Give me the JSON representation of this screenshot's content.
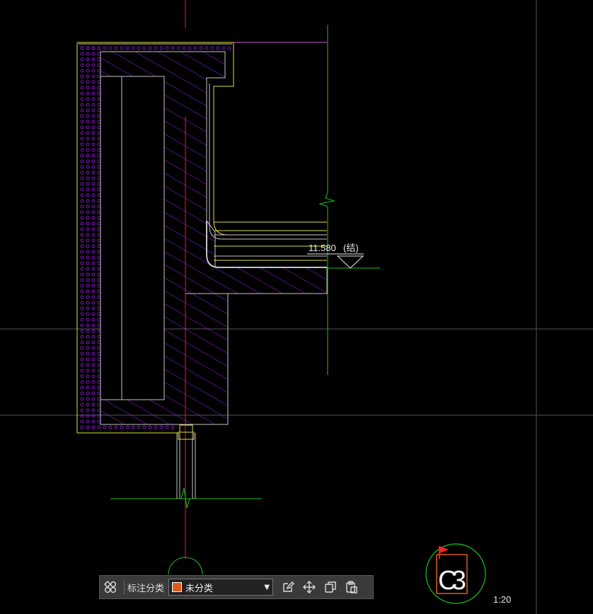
{
  "drawing": {
    "elevation_label": "11.580",
    "elevation_note": "(结)",
    "detail_id": "C3",
    "scale": "1:20"
  },
  "toolbar": {
    "label": "标注分类",
    "category_value": "未分类",
    "category_color": "#e05a1a"
  },
  "colors": {
    "background": "#000000",
    "concrete_outline": "#c4c4c4",
    "hatch": "#a020f0",
    "membrane": "#e0e040",
    "axis_red": "#ff1a1a",
    "axis_green": "#20c020"
  },
  "icons": [
    "grid-icon",
    "edit-icon",
    "move-icon",
    "copy-icon",
    "paste-icon",
    "chevron-down-icon",
    "flag-icon"
  ]
}
